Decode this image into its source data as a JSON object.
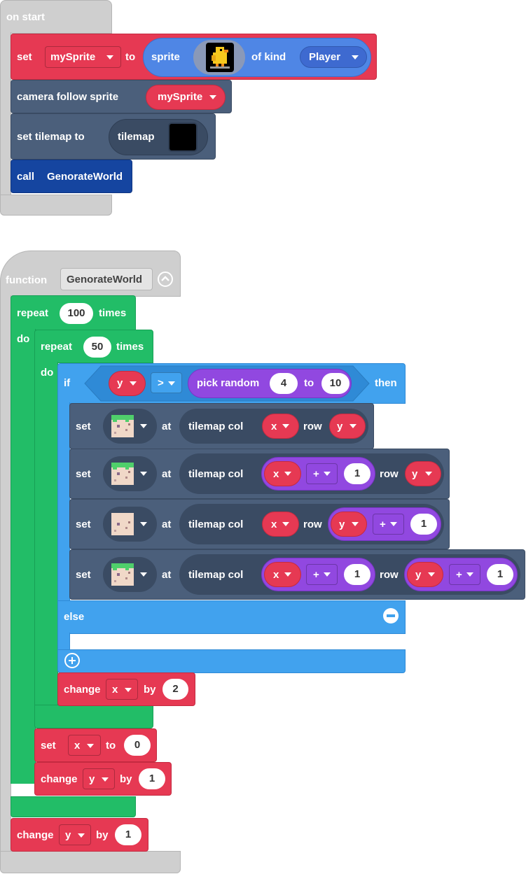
{
  "on_start": {
    "hat_label": "on start",
    "set_label": "set",
    "var_name": "mySprite",
    "to_label": "to",
    "sprite_label": "sprite",
    "of_kind_label": "of kind",
    "kind_value": "Player",
    "camera_follow_label": "camera follow sprite",
    "camera_var": "mySprite",
    "set_tilemap_label": "set tilemap to",
    "tilemap_label": "tilemap",
    "call_label": "call",
    "call_name": "GenorateWorld"
  },
  "function_block": {
    "function_label": "function",
    "function_name": "GenorateWorld",
    "repeat_outer_label": "repeat",
    "repeat_outer_count": "100",
    "times_label": "times",
    "do_label": "do",
    "repeat_inner_label": "repeat",
    "repeat_inner_count": "50",
    "if_label": "if",
    "if_var": "y",
    "if_op": ">",
    "pick_random_label": "pick random",
    "rand_min": "4",
    "rand_to": "to",
    "rand_max": "10",
    "then_label": "then",
    "set_label": "set",
    "at_label": "at",
    "tilemap_col_label": "tilemap col",
    "row_label": "row",
    "x_var": "x",
    "y_var": "y",
    "plus_op": "+",
    "one": "1",
    "else_label": "else",
    "change_label": "change",
    "by_label": "by",
    "change_x_amount": "2",
    "set_x_to_value": "0",
    "change_y_amount": "1",
    "final_change_y_amount": "1"
  },
  "colors": {
    "events": "#cfcfcf",
    "variables": "#e63953",
    "scene": "#4b5f7b",
    "functions": "#1545a0",
    "loops": "#22bd67",
    "logic": "#41a2ee",
    "math": "#9148e0",
    "sprites": "#4f86e5"
  }
}
